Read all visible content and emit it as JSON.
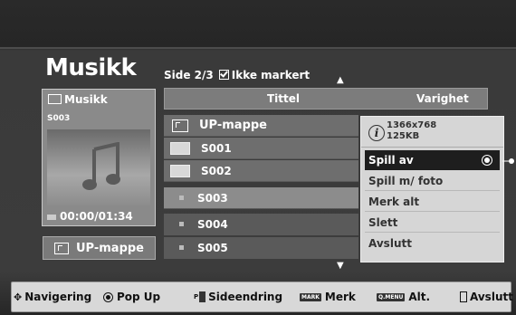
{
  "header": {
    "title": "Musikk",
    "page_info": "Side 2/3",
    "filter_label": "Ikke markert"
  },
  "preview": {
    "folder_name": "Musikk",
    "file_code": "S003",
    "time": "00:00/01:34",
    "up_button_label": "UP-mappe",
    "icons": {
      "folder": "folder-icon",
      "music": "music-note-icon"
    }
  },
  "list": {
    "columns": [
      "Tittel",
      "Varighet"
    ],
    "rows": [
      {
        "label": "UP-mappe",
        "type": "parent-folder"
      },
      {
        "label": "S001",
        "type": "folder"
      },
      {
        "label": "S002",
        "type": "folder"
      },
      {
        "label": "S003",
        "type": "file",
        "selected": true
      },
      {
        "label": "S004",
        "type": "file"
      },
      {
        "label": "S005",
        "type": "file"
      }
    ]
  },
  "popup": {
    "resolution": "1366x768",
    "size": "125KB",
    "items": [
      "Spill av",
      "Spill m/ foto",
      "Merk alt",
      "Slett",
      "Avslutt"
    ],
    "active_index": 0
  },
  "footer": {
    "hints": [
      {
        "label": "Navigering"
      },
      {
        "label": "Pop Up"
      },
      {
        "label": "Sideendring",
        "key": "P"
      },
      {
        "label": "Merk",
        "key": "MARK"
      },
      {
        "label": "Alt.",
        "key": "Q.MENU"
      },
      {
        "label": "Avslutt"
      }
    ]
  },
  "colors": {
    "background": "#3a3a3a",
    "popup_bg": "#d6d6d6",
    "highlight": "#1e1e1e",
    "footer_bg": "#d8d8d8"
  }
}
